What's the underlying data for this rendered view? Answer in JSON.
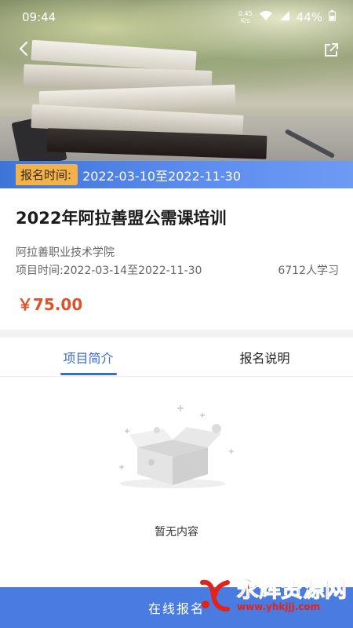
{
  "status_bar": {
    "time": "09:44",
    "net_speed_value": "0.45",
    "net_speed_unit": "K/s",
    "battery": "44%"
  },
  "registration": {
    "tag": "报名时间:",
    "range": "2022-03-10至2022-11-30"
  },
  "course": {
    "title": "2022年阿拉善盟公需课培训",
    "institution": "阿拉善职业技术学院",
    "project_time": "项目时间:2022-03-14至2022-11-30",
    "learners": "6712人学习",
    "price": "￥75.00"
  },
  "tabs": [
    {
      "label": "项目简介",
      "active": true
    },
    {
      "label": "报名说明",
      "active": false
    }
  ],
  "empty_state": {
    "text": "暂无内容"
  },
  "bottom": {
    "button_label": "在线报名"
  },
  "watermark": {
    "title": "永辉资源网",
    "url": "www.yhkjjj.com"
  },
  "colors": {
    "accent": "#3a6bd1",
    "price": "#d9532b",
    "reg_tag": "#f2b24a",
    "bottom_bar": "#4a7be0"
  },
  "icons": {
    "back": "chevron-left-icon",
    "share": "share-icon",
    "wifi": "wifi-icon",
    "battery": "battery-icon",
    "empty": "empty-box-icon"
  }
}
